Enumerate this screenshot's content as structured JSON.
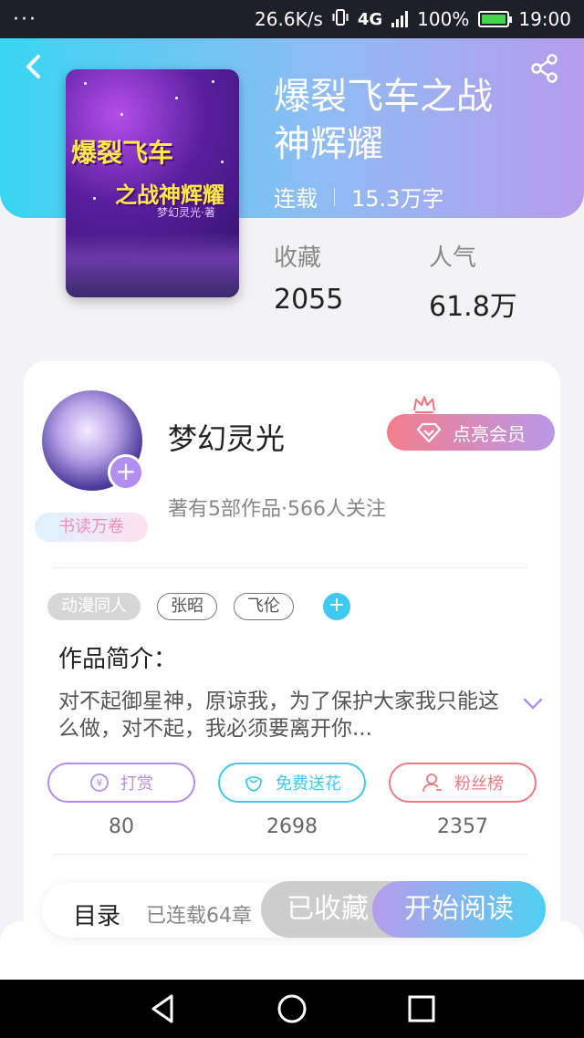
{
  "status_bar": {
    "dots": "···",
    "speed": "26.6K/s",
    "network": "4G",
    "battery": "100%",
    "time": "19:00"
  },
  "book": {
    "title_line1": "爆裂飞车之战",
    "title_line2": "神辉耀",
    "status": "连载",
    "word_count": "15.3万字",
    "cover_text_1": "爆裂飞车",
    "cover_text_2": "之战神辉耀",
    "cover_text_3": "梦幻灵光·著"
  },
  "stats": {
    "favorites_label": "收藏",
    "favorites_value": "2055",
    "popularity_label": "人气",
    "popularity_value": "61.8万"
  },
  "author": {
    "name": "梦幻灵光",
    "summary": "著有5部作品·566人关注",
    "badge": "书读万卷",
    "vip_button": "点亮会员"
  },
  "tags": [
    "动漫同人",
    "张昭",
    "飞伦"
  ],
  "intro": {
    "title": "作品简介：",
    "text": "对不起御星神，原谅我，为了保护大家我只能这么做，对不起，我必须要离开你..."
  },
  "actions": [
    {
      "label": "打赏",
      "count": "80",
      "color": "#b28ef0"
    },
    {
      "label": "免费送花",
      "count": "2698",
      "color": "#3fc9ef"
    },
    {
      "label": "粉丝榜",
      "count": "2357",
      "color": "#f07a84"
    }
  ],
  "bottom": {
    "toc_label": "目录",
    "toc_count": "已连载64章",
    "favorited_button": "已收藏",
    "read_button": "开始阅读"
  },
  "icons": {
    "back": "chevron-left-icon",
    "share": "share-icon",
    "nav_back": "triangle-back-icon",
    "nav_home": "circle-home-icon",
    "nav_recent": "square-recent-icon"
  }
}
